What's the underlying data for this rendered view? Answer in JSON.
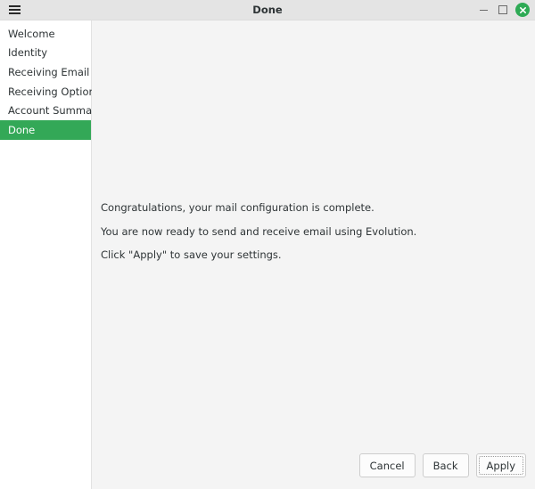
{
  "titlebar": {
    "title": "Done",
    "menu_icon": "hamburger-menu-icon",
    "minimize_label": "–",
    "maximize_label": "□",
    "close_label": "✕",
    "close_color": "#2eaa55"
  },
  "sidebar": {
    "selected": "Done",
    "selected_color": "#33a857",
    "items": [
      {
        "label": "Welcome"
      },
      {
        "label": "Identity"
      },
      {
        "label": "Receiving Email"
      },
      {
        "label": "Receiving Options"
      },
      {
        "label": "Account Summary"
      },
      {
        "label": "Done"
      }
    ]
  },
  "content": {
    "lines": [
      "Congratulations, your mail configuration is complete.",
      "You are now ready to send and receive email using Evolution.",
      "Click \"Apply\" to save your settings."
    ]
  },
  "buttons": {
    "cancel": "Cancel",
    "back": "Back",
    "apply": "Apply"
  }
}
